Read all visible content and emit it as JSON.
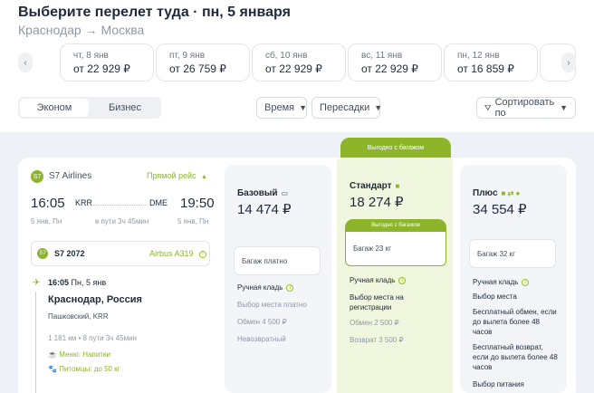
{
  "header": {
    "title": "Выберите перелет туда · пн, 5 января",
    "route_from": "Краснодар",
    "route_arrow": "→",
    "route_to": "Москва"
  },
  "dates": [
    {
      "day": "чт, 8 янв",
      "price": "от 22 929 ₽"
    },
    {
      "day": "пт, 9 янв",
      "price": "от 26 759 ₽"
    },
    {
      "day": "сб, 10 янв",
      "price": "от 22 929 ₽"
    },
    {
      "day": "вс, 11 янв",
      "price": "от 22 929 ₽"
    },
    {
      "day": "пн, 12 янв",
      "price": "от 16 859 ₽"
    }
  ],
  "nav": {
    "prev": "‹",
    "next": "›"
  },
  "class_toggle": {
    "economy": "Эконом",
    "business": "Бизнес"
  },
  "filters": {
    "time": "Время",
    "transfers": "Пересадки",
    "sort": "Сортировать по"
  },
  "flight": {
    "airline": "S7 Airlines",
    "direct": "Прямой рейс",
    "dep_time": "16:05",
    "dep_code": "KRR",
    "arr_code": "DME",
    "arr_time": "19:50",
    "dep_date": "5 янв, Пн",
    "duration": "в пути 3ч 45мин",
    "arr_date": "5 янв, Пн",
    "flight_no": "S7 2072",
    "aircraft": "Airbus A319",
    "seg_time": "16:05",
    "seg_date": "Пн, 5 янв",
    "seg_city": "Краснодар, Россия",
    "seg_airport": "Пашковский, KRR",
    "seg_info": "1 181 км  •  8 пути 3ч 45мин",
    "meal": "Меню: Напитки",
    "pets": "Питомцы: до 50 кг"
  },
  "fares": {
    "featured_badge": "Выгодно с багажом",
    "basic": {
      "name": "Базовый",
      "price": "14 474 ₽",
      "bag": "Багаж платно",
      "f1": "Ручная кладь",
      "f2": "Выбор места платно",
      "f3": "Обмен 4 500 ₽",
      "f4": "Невозвратный"
    },
    "standard": {
      "name": "Стандарт",
      "price": "18 274 ₽",
      "sub_badge": "Выгодно с багажом",
      "bag": "Багаж 23 кг",
      "f1": "Ручная кладь",
      "f2": "Выбор места на регистрации",
      "f3": "Обмен 2 500 ₽",
      "f4": "Возврат 3 500 ₽"
    },
    "plus": {
      "name": "Плюс",
      "price": "34 554 ₽",
      "bag": "Багаж 32 кг",
      "f1": "Ручная кладь",
      "f2": "Выбор места",
      "f3": "Бесплатный обмен, если до вылета более 48 часов",
      "f4": "Бесплатный возврат, если до вылета более 48 часов",
      "f5": "Выбор питания"
    }
  },
  "colors": {
    "accent": "#8cb52a",
    "standard_bg": "#f1f7de",
    "col_bg": "#f3f5f8"
  }
}
